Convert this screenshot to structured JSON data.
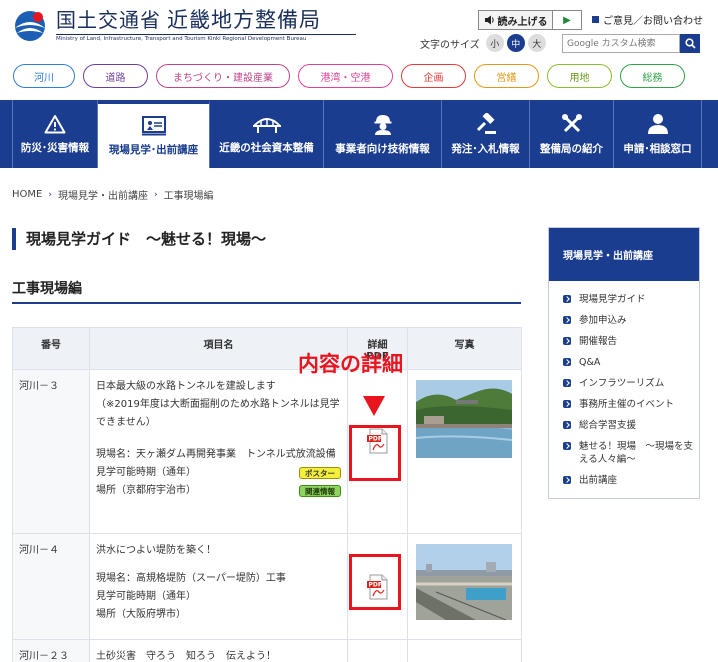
{
  "header": {
    "logo_title": "国土交通省",
    "logo_bureau": "近畿地方整備局",
    "logo_subtitle": "Ministry of Land, Infrastructure, Transport and Tourism Kinki Regional Development Bureau",
    "read_aloud": "読み上げる",
    "opinion_link": "ご意見／お問い合わせ",
    "font_size_label": "文字のサイズ",
    "font_sizes": [
      "小",
      "中",
      "大"
    ],
    "font_size_active": "中",
    "search_placeholder": "Google カスタム検索"
  },
  "categories": [
    {
      "label": "河川",
      "color": "#2e7fd6"
    },
    {
      "label": "道路",
      "color": "#6b3f9e"
    },
    {
      "label": "まちづくり・建設産業",
      "color": "#c0438c"
    },
    {
      "label": "港湾・空港",
      "color": "#e0409a"
    },
    {
      "label": "企画",
      "color": "#e03a3a"
    },
    {
      "label": "営繕",
      "color": "#e09a1a"
    },
    {
      "label": "用地",
      "color": "#8bbf2e"
    },
    {
      "label": "総務",
      "color": "#2fa34a"
    }
  ],
  "gnav": [
    {
      "label": "防災･災害情報",
      "icon": "warning-icon"
    },
    {
      "label": "現場見学･出前講座",
      "icon": "presentation-icon",
      "active": true
    },
    {
      "label": "近畿の社会資本整備",
      "icon": "bridge-icon"
    },
    {
      "label": "事業者向け技術情報",
      "icon": "worker-icon"
    },
    {
      "label": "発注･入札情報",
      "icon": "gavel-icon"
    },
    {
      "label": "整備局の紹介",
      "icon": "tools-icon"
    },
    {
      "label": "申請･相談窓口",
      "icon": "person-icon"
    }
  ],
  "breadcrumb": [
    "HOME",
    "現場見学・出前講座",
    "工事現場編"
  ],
  "page_title": "現場見学ガイド　～魅せる！現場～",
  "section_title": "工事現場編",
  "table": {
    "headers": [
      "番号",
      "項目名",
      "詳細PDF",
      "写真"
    ],
    "header_pdf_line1": "詳細",
    "header_pdf_line2": "PDF",
    "rows": [
      {
        "number": "河川－３",
        "title": "日本最大級の水路トンネルを建設します",
        "note": "（※2019年度は大断面掘削のため水路トンネルは見学できません）",
        "site": "現場名：天ヶ瀬ダム再開発事業　トンネル式放流設備",
        "period": "見学可能時期（通年）",
        "place": "場所（京都府宇治市）",
        "tag_poster": "ポスター",
        "tag_related": "関連情報"
      },
      {
        "number": "河川－４",
        "title": "洪水につよい堤防を築く！",
        "site": "現場名：高規格堤防（スーパー堤防）工事",
        "period": "見学可能時期（通年）",
        "place": "場所（大阪府堺市）"
      },
      {
        "number": "河川－２３",
        "title": "土砂災害　守ろう　知ろう　伝えよう！"
      }
    ]
  },
  "annotation": {
    "label": "内容の詳細",
    "color": "#e8141e"
  },
  "sidebar": {
    "title": "現場見学・出前講座",
    "items": [
      "現場見学ガイド",
      "参加申込み",
      "開催報告",
      "Q&A",
      "インフラツーリズム",
      "事務所主催のイベント",
      "総合学習支援",
      "魅せる！現場　～現場を支える人々編～",
      "出前講座"
    ]
  },
  "colors": {
    "brand": "#1a3d8f",
    "accent_red": "#e8141e"
  }
}
